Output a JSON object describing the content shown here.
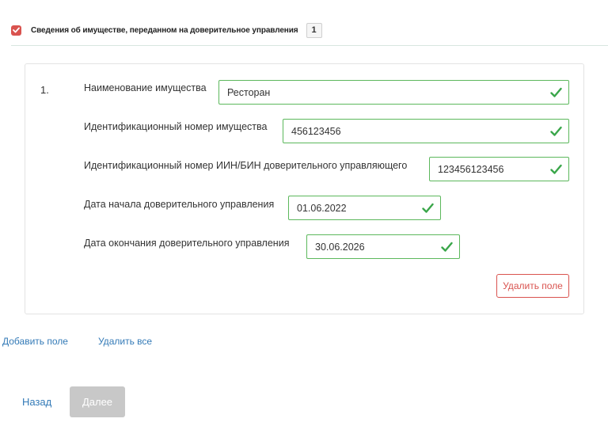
{
  "section": {
    "title": "Сведения об имуществе, переданном на доверительное управления",
    "count": "1",
    "checked": true
  },
  "item": {
    "number": "1.",
    "fields": [
      {
        "label": "Наименование имущества",
        "value": "Ресторан",
        "valid": true
      },
      {
        "label": "Идентификационный номер имущества",
        "value": "456123456",
        "valid": true
      },
      {
        "label": "Идентификационный номер ИИН/БИН доверительного управляющего",
        "value": "123456123456",
        "valid": true
      },
      {
        "label": "Дата начала доверительного управления",
        "value": "01.06.2022",
        "valid": true
      },
      {
        "label": "Дата окончания доверительного управления",
        "value": "30.06.2026",
        "valid": true
      }
    ],
    "remove_label": "Удалить поле"
  },
  "actions": {
    "add_field": "Добавить поле",
    "remove_all": "Удалить все"
  },
  "nav": {
    "back": "Назад",
    "next": "Далее"
  },
  "colors": {
    "valid": "#5cb85c",
    "danger": "#d9534f",
    "link": "#337ab7",
    "disabled": "#c8c8c8"
  }
}
